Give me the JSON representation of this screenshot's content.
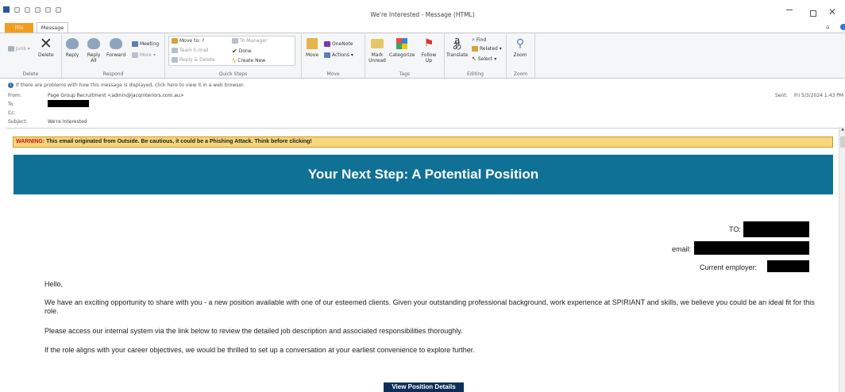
{
  "window": {
    "title": "We're Interested - Message (HTML)"
  },
  "tabs": {
    "file": "File",
    "message": "Message"
  },
  "ribbon": {
    "delete_group": {
      "label": "Delete",
      "junk": "Junk",
      "delete": "Delete"
    },
    "respond_group": {
      "label": "Respond",
      "reply": "Reply",
      "reply_all": "Reply All",
      "forward": "Forward",
      "meeting": "Meeting",
      "more": "More"
    },
    "quick_steps_group": {
      "label": "Quick Steps",
      "move_to": "Move to: ?",
      "team_email": "Team E-mail",
      "reply_delete": "Reply & Delete",
      "to_manager": "To Manager",
      "done": "Done",
      "create_new": "Create New"
    },
    "move_group": {
      "label": "Move",
      "move": "Move",
      "onenote": "OneNote",
      "actions": "Actions"
    },
    "tags_group": {
      "label": "Tags",
      "mark_unread": "Mark Unread",
      "categorize": "Categorize",
      "follow_up": "Follow Up"
    },
    "editing_group": {
      "label": "Editing",
      "translate": "Translate",
      "find": "Find",
      "related": "Related",
      "select": "Select"
    },
    "zoom_group": {
      "label": "Zoom",
      "zoom": "Zoom"
    }
  },
  "infobar": {
    "text": "If there are problems with how this message is displayed, click here to view it in a web browser."
  },
  "headers": {
    "from_label": "From:",
    "from_value": "Page Group Recruitment <admin@jacqinteriors.com.au>",
    "to_label": "To:",
    "cc_label": "Cc:",
    "subject_label": "Subject:",
    "subject_value": "We're Interested",
    "sent_label": "Sent:",
    "sent_value": "Fri 5/3/2024 1:43 PM"
  },
  "message": {
    "warning_label": "WARNING:",
    "warning_text": " This email originated from Outside. Be cautious, it could be a Phishing Attack. Think before clicking!",
    "banner_title": "Your Next Step: A Potential Position",
    "recipient_to_label": "TO:",
    "recipient_email_label": "email:",
    "recipient_employer_label": "Current employer:",
    "greeting": "Hello,",
    "paragraph1": "We have an exciting opportunity to share with you - a new position available with one of our esteemed clients. Given your outstanding professional background, work experience at SPIRIANT and skills, we believe you could be an ideal fit for this role.",
    "paragraph2": "Please access our internal system via the link below to review the detailed job description and associated responsibilities thoroughly.",
    "paragraph3": "If the role aligns with your career objectives, we would be thrilled to set up a conversation at your earliest convenience to explore further.",
    "view_button": "View Position Details"
  },
  "colors": {
    "file_tab": "#f39c1f",
    "banner": "#0f7196",
    "warning_bg": "#f7d67c",
    "warning_label": "#d01010",
    "button": "#0d2e59"
  }
}
